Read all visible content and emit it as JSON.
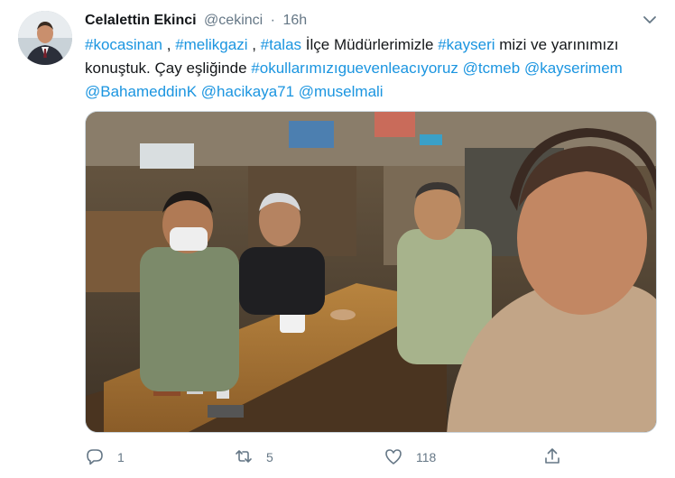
{
  "tweet": {
    "author_name": "Celalettin Ekinci",
    "handle": "@cekinci",
    "separator": "·",
    "time": "16h",
    "text_parts": [
      {
        "text": "#kocasinan",
        "link": true
      },
      {
        "text": " , ",
        "link": false
      },
      {
        "text": "#melikgazi",
        "link": true
      },
      {
        "text": " , ",
        "link": false
      },
      {
        "text": "#talas",
        "link": true
      },
      {
        "text": " İlçe Müdürlerimizle ",
        "link": false
      },
      {
        "text": "#kayseri",
        "link": true
      },
      {
        "text": " mizi ve yarınımızı konuştuk. Çay eşliğinde  ",
        "link": false
      },
      {
        "text": "#okullarımızıguevenleacıyoruz",
        "link": true
      },
      {
        "text": " ",
        "link": false
      },
      {
        "text": "@tcmeb",
        "link": true
      },
      {
        "text": " ",
        "link": false
      },
      {
        "text": "@kayserimem",
        "link": true
      },
      {
        "text": " ",
        "link": false
      },
      {
        "text": "@BahameddinK",
        "link": true
      },
      {
        "text": " ",
        "link": false
      },
      {
        "text": "@hacikaya71",
        "link": true
      },
      {
        "text": " ",
        "link": false
      },
      {
        "text": "@muselmali",
        "link": true
      }
    ],
    "media_alt": "photo",
    "actions": {
      "reply_count": "1",
      "retweet_count": "5",
      "like_count": "118",
      "share_label": ""
    }
  },
  "icons": {
    "caret": "chevron-down-icon",
    "reply": "reply-icon",
    "retweet": "retweet-icon",
    "like": "heart-icon",
    "share": "share-icon"
  },
  "colors": {
    "link": "#1b95e0",
    "secondary_text": "#657786",
    "primary_text": "#14171a"
  }
}
